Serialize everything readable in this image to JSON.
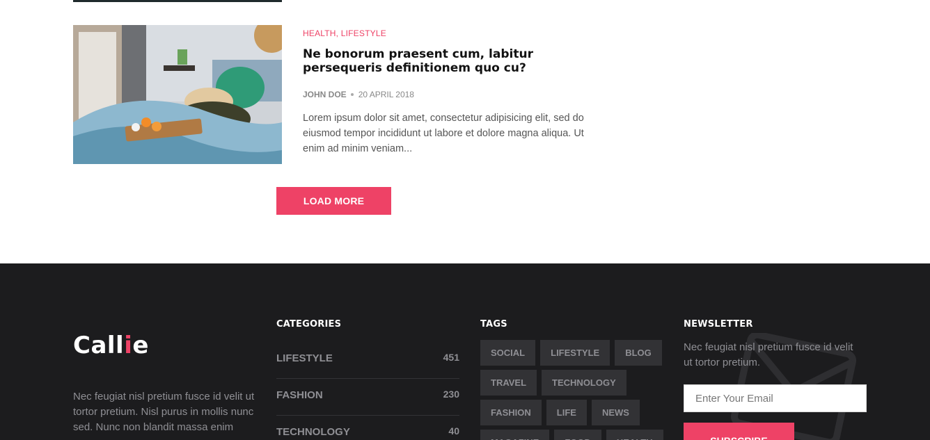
{
  "colors": {
    "accent": "#ee4266",
    "footer_bg": "#1c1c1e",
    "tag_bg": "#323235"
  },
  "post": {
    "categories": [
      "HEALTH",
      "LIFESTYLE"
    ],
    "title": "Ne bonorum praesent cum, labitur persequeris definitionem quo cu?",
    "author": "JOHN DOE",
    "date": "20 APRIL 2018",
    "excerpt": "Lorem ipsum dolor sit amet, consectetur adipisicing elit, sed do eiusmod tempor incididunt ut labore et dolore magna aliqua. Ut enim ad minim veniam...",
    "thumbnail_icon": "woman-in-bed-photo"
  },
  "load_more_label": "LOAD MORE",
  "footer": {
    "brand": {
      "text_before": "Call",
      "accent_text": "i",
      "text_after": "e"
    },
    "about": "Nec feugiat nisl pretium fusce id velit ut tortor pretium. Nisl purus in mollis nunc sed. Nunc non blandit massa enim nec.",
    "categories_heading": "CATEGORIES",
    "categories": [
      {
        "name": "LIFESTYLE",
        "count": "451"
      },
      {
        "name": "FASHION",
        "count": "230"
      },
      {
        "name": "TECHNOLOGY",
        "count": "40"
      }
    ],
    "tags_heading": "TAGS",
    "tags": [
      "SOCIAL",
      "LIFESTYLE",
      "BLOG",
      "TRAVEL",
      "TECHNOLOGY",
      "FASHION",
      "LIFE",
      "NEWS",
      "MAGAZINE",
      "FOOD",
      "HEALTH"
    ],
    "newsletter_heading": "NEWSLETTER",
    "newsletter_text": "Nec feugiat nisl pretium fusce id velit ut tortor pretium.",
    "email_placeholder": "Enter Your Email",
    "subscribe_label": "SUBSCRIBE",
    "newsletter_icon": "envelope-icon"
  }
}
